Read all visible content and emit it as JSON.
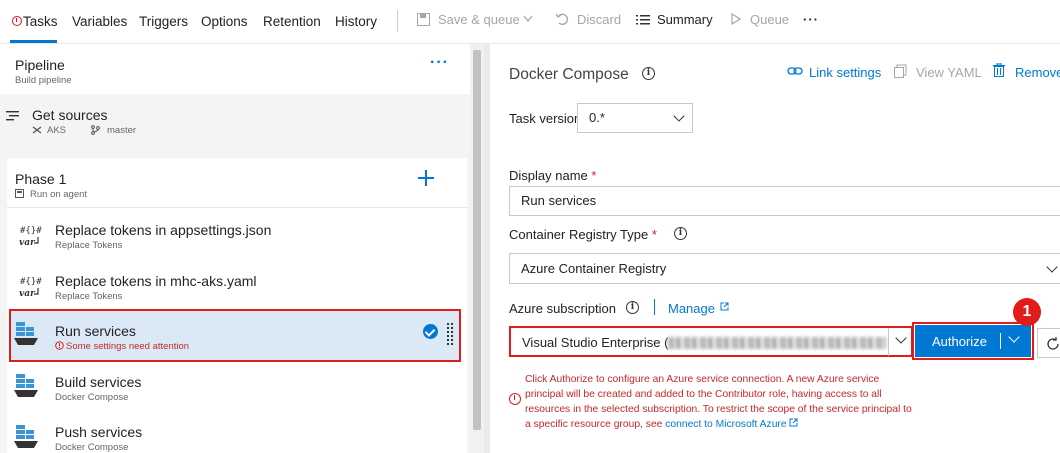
{
  "tabs": [
    "Tasks",
    "Variables",
    "Triggers",
    "Options",
    "Retention",
    "History"
  ],
  "toolbar": {
    "save_queue": "Save & queue",
    "discard": "Discard",
    "summary": "Summary",
    "queue": "Queue",
    "more": "···"
  },
  "pipeline": {
    "title": "Pipeline",
    "subtitle": "Build pipeline",
    "more": "···"
  },
  "get_sources": {
    "title": "Get sources",
    "repo": "AKS",
    "branch": "master"
  },
  "phase": {
    "title": "Phase 1",
    "subtitle": "Run on agent"
  },
  "tasks": [
    {
      "title": "Replace tokens in appsettings.json",
      "subtitle": "Replace Tokens"
    },
    {
      "title": "Replace tokens in mhc-aks.yaml",
      "subtitle": "Replace Tokens"
    },
    {
      "title": "Run services",
      "subtitle": "Some settings need attention"
    },
    {
      "title": "Build services",
      "subtitle": "Docker Compose"
    },
    {
      "title": "Push services",
      "subtitle": "Docker Compose"
    }
  ],
  "detail": {
    "title": "Docker Compose",
    "link_settings": "Link settings",
    "view_yaml": "View YAML",
    "remove": "Remove",
    "task_version_label": "Task version",
    "task_version_value": "0.*",
    "display_name_label": "Display name",
    "display_name_value": "Run services",
    "registry_type_label": "Container Registry Type",
    "registry_type_value": "Azure Container Registry",
    "subscription_label": "Azure subscription",
    "manage": "Manage",
    "subscription_value": "Visual Studio Enterprise (",
    "authorize": "Authorize",
    "badge": "1",
    "error_text": "Click Authorize to configure an Azure service connection. A new Azure service principal will be created and added to the Contributor role, having access to all resources in the selected subscription. To restrict the scope of the service principal to a specific resource group, see",
    "error_link": "connect to Microsoft Azure"
  },
  "colors": {
    "accent": "#0078d4",
    "error": "#e21b1b",
    "selected_bg": "#dbe9f7"
  }
}
